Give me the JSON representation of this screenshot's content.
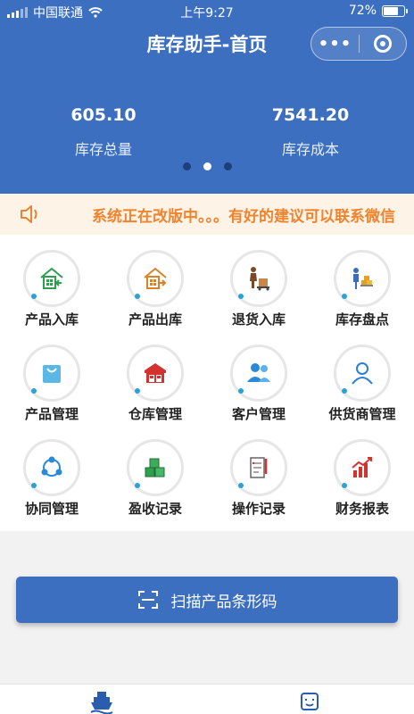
{
  "status_bar": {
    "carrier": "中国联通",
    "time": "上午9:27",
    "battery": "72%",
    "battery_level": 0.72
  },
  "header": {
    "title": "库存助手-首页",
    "capsule": {
      "more_label": "•••"
    },
    "stats": [
      {
        "value": "605.10",
        "label": "库存总量"
      },
      {
        "value": "7541.20",
        "label": "库存成本"
      }
    ],
    "carousel": {
      "pages": 3,
      "active": 2
    }
  },
  "notice": {
    "text": "系统正在改版中。。。有好的建议可以联系微信"
  },
  "menu": [
    {
      "label": "产品入库",
      "icon": "product-inbound-icon"
    },
    {
      "label": "产品出库",
      "icon": "product-outbound-icon"
    },
    {
      "label": "退货入库",
      "icon": "return-inbound-icon"
    },
    {
      "label": "库存盘点",
      "icon": "inventory-count-icon"
    },
    {
      "label": "产品管理",
      "icon": "shopping-bag-icon"
    },
    {
      "label": "仓库管理",
      "icon": "warehouse-icon"
    },
    {
      "label": "客户管理",
      "icon": "customers-icon"
    },
    {
      "label": "供货商管理",
      "icon": "supplier-icon"
    },
    {
      "label": "协同管理",
      "icon": "collaboration-icon"
    },
    {
      "label": "盈收记录",
      "icon": "boxes-icon"
    },
    {
      "label": "操作记录",
      "icon": "checklist-icon"
    },
    {
      "label": "财务报表",
      "icon": "bar-chart-icon"
    }
  ],
  "scan_button": {
    "label": "扫描产品条形码"
  },
  "colors": {
    "primary": "#3d6fc0",
    "notice_text": "#f0832e",
    "notice_bg": "#fdf3e7"
  }
}
